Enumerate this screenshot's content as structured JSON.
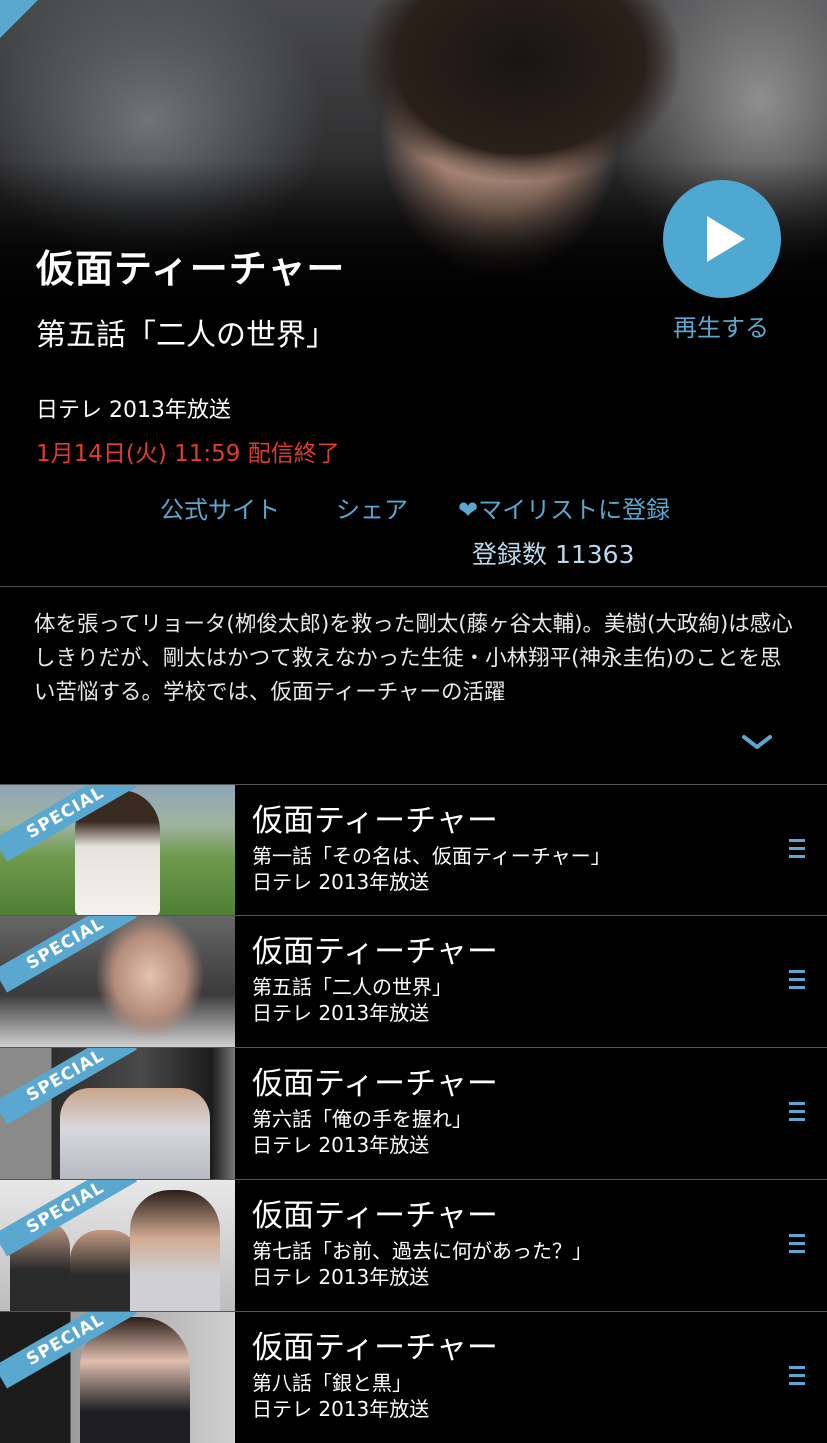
{
  "header": {
    "title": "仮面ティーチャー",
    "episode": "第五話「二人の世界」",
    "play_label": "再生する",
    "broadcast": "日テレ 2013年放送",
    "expire": "1月14日(火) 11:59 配信終了"
  },
  "actions": {
    "official": "公式サイト",
    "share": "シェア",
    "mylist": "❤マイリストに登録",
    "count": "登録数 11363"
  },
  "description": "体を張ってリョータ(栁俊太郎)を救った剛太(藤ヶ谷太輔)。美樹(大政絢)は感心しきりだが、剛太はかつて救えなかった生徒・小林翔平(神永圭佑)のことを思い苦悩する。学校では、仮面ティーチャーの活躍",
  "badge_text": "SPECIAL",
  "episodes": [
    {
      "title": "仮面ティーチャー",
      "name": "第一話「その名は、仮面ティーチャー」",
      "meta": "日テレ  2013年放送"
    },
    {
      "title": "仮面ティーチャー",
      "name": "第五話「二人の世界」",
      "meta": "日テレ  2013年放送"
    },
    {
      "title": "仮面ティーチャー",
      "name": "第六話「俺の手を握れ」",
      "meta": "日テレ  2013年放送"
    },
    {
      "title": "仮面ティーチャー",
      "name": "第七話「お前、過去に何があった？」",
      "meta": "日テレ  2013年放送"
    },
    {
      "title": "仮面ティーチャー",
      "name": "第八話「銀と黒」",
      "meta": "日テレ  2013年放送"
    }
  ],
  "colors": {
    "accent": "#5aa8cf",
    "expire": "#e23b2e",
    "background": "#000000"
  }
}
